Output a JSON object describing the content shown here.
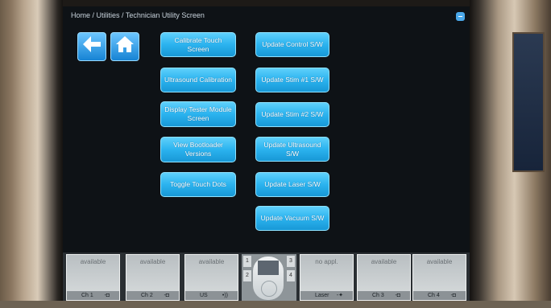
{
  "breadcrumb": "Home / Utilities / Technician Utility Screen",
  "nav": {
    "back_icon": "arrow-left-icon",
    "home_icon": "home-icon"
  },
  "left_buttons": [
    "Calibrate Touch Screen",
    "Ultrasound Calibration",
    "Display Tester Module Screen",
    "View Bootloader Versions",
    "Toggle Touch Dots"
  ],
  "right_buttons": [
    "Update Control S/W",
    "Update Stim #1 S/W",
    "Update Stim #2 S/W",
    "Update Ultrasound S/W",
    "Update Laser S/W",
    "Update Vacuum S/W"
  ],
  "channels": [
    {
      "status": "available",
      "label": "Ch 1"
    },
    {
      "status": "available",
      "label": "Ch 2"
    },
    {
      "status": "available",
      "label": "US"
    },
    {
      "status": "no appl.",
      "label": "Laser"
    },
    {
      "status": "available",
      "label": "Ch 3"
    },
    {
      "status": "available",
      "label": "Ch 4"
    }
  ],
  "remote": {
    "numbers": [
      "1",
      "2",
      "3",
      "4"
    ]
  },
  "colors": {
    "button": "#2bb3ef",
    "screen_bg": "#0e1216"
  }
}
